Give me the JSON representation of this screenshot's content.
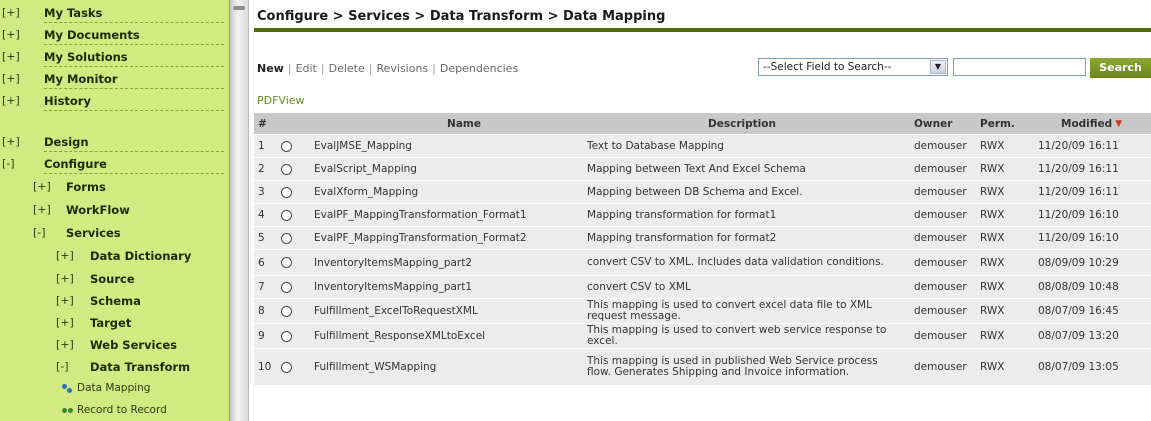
{
  "nav": {
    "top_items": [
      {
        "toggle": "[+]",
        "label": "My Tasks"
      },
      {
        "toggle": "[+]",
        "label": "My Documents"
      },
      {
        "toggle": "[+]",
        "label": "My Solutions"
      },
      {
        "toggle": "[+]",
        "label": "My Monitor"
      },
      {
        "toggle": "[+]",
        "label": "History"
      }
    ],
    "design": {
      "toggle": "[+]",
      "label": "Design"
    },
    "configure": {
      "toggle": "[-]",
      "label": "Configure"
    },
    "configure_children": [
      {
        "toggle": "[+]",
        "label": "Forms"
      },
      {
        "toggle": "[+]",
        "label": "WorkFlow"
      },
      {
        "toggle": "[-]",
        "label": "Services"
      }
    ],
    "services_children": [
      {
        "toggle": "[+]",
        "label": "Data Dictionary"
      },
      {
        "toggle": "[+]",
        "label": "Source"
      },
      {
        "toggle": "[+]",
        "label": "Schema"
      },
      {
        "toggle": "[+]",
        "label": "Target"
      },
      {
        "toggle": "[+]",
        "label": "Web Services"
      },
      {
        "toggle": "[-]",
        "label": "Data Transform"
      }
    ],
    "transform_children": [
      {
        "label": "Data Mapping",
        "icon": "data-mapping-icon"
      },
      {
        "label": "Record to Record",
        "icon": "record-to-record-icon"
      }
    ]
  },
  "breadcrumb": "Configure > Services > Data Transform > Data Mapping",
  "toolbar": {
    "new": "New",
    "edit": "Edit",
    "delete": "Delete",
    "revisions": "Revisions",
    "dependencies": "Dependencies",
    "separator": "|"
  },
  "search": {
    "field_select": "--Select Field to Search--",
    "input_value": "",
    "button": "Search"
  },
  "pdfview": "PDFView",
  "table": {
    "columns": {
      "num": "#",
      "name": "Name",
      "description": "Description",
      "owner": "Owner",
      "perm": "Perm.",
      "modified": "Modified"
    },
    "sort_indicator": "▼",
    "rows": [
      {
        "num": "1",
        "name": "EvalJMSE_Mapping",
        "description": "Text to Database Mapping",
        "owner": "demouser",
        "perm": "RWX",
        "modified": "11/20/09 16:11"
      },
      {
        "num": "2",
        "name": "EvalScript_Mapping",
        "description": "Mapping between Text And Excel Schema",
        "owner": "demouser",
        "perm": "RWX",
        "modified": "11/20/09 16:11"
      },
      {
        "num": "3",
        "name": "EvalXform_Mapping",
        "description": "Mapping between DB Schema and Excel.",
        "owner": "demouser",
        "perm": "RWX",
        "modified": "11/20/09 16:11"
      },
      {
        "num": "4",
        "name": "EvalPF_MappingTransformation_Format1",
        "description": "Mapping transformation for format1",
        "owner": "demouser",
        "perm": "RWX",
        "modified": "11/20/09 16:10"
      },
      {
        "num": "5",
        "name": "EvalPF_MappingTransformation_Format2",
        "description": "Mapping transformation for format2",
        "owner": "demouser",
        "perm": "RWX",
        "modified": "11/20/09 16:10"
      },
      {
        "num": "6",
        "name": "InventoryItemsMapping_part2",
        "description": "convert CSV to XML. Includes data validation conditions.",
        "owner": "demouser",
        "perm": "RWX",
        "modified": "08/09/09 10:29"
      },
      {
        "num": "7",
        "name": "InventoryItemsMapping_part1",
        "description": "convert CSV to XML",
        "owner": "demouser",
        "perm": "RWX",
        "modified": "08/08/09 10:48"
      },
      {
        "num": "8",
        "name": "Fulfillment_ExcelToRequestXML",
        "description": "This mapping is used to convert excel data file to XML request message.",
        "owner": "demouser",
        "perm": "RWX",
        "modified": "08/07/09 16:45"
      },
      {
        "num": "9",
        "name": "Fulfillment_ResponseXMLtoExcel",
        "description": "This mapping is used to convert web service response to excel.",
        "owner": "demouser",
        "perm": "RWX",
        "modified": "08/07/09 13:20"
      },
      {
        "num": "10",
        "name": "Fulfillment_WSMapping",
        "description": "This mapping is used in published Web Service process flow. Generates Shipping and Invoice information.",
        "owner": "demouser",
        "perm": "RWX",
        "modified": "08/07/09 13:05"
      }
    ]
  },
  "colors": {
    "sidebar_bg": "#d3ea83",
    "accent": "#556b10",
    "button": "#7a9428",
    "row_bg": "#ececec",
    "header_bg": "#c8c8c8"
  }
}
